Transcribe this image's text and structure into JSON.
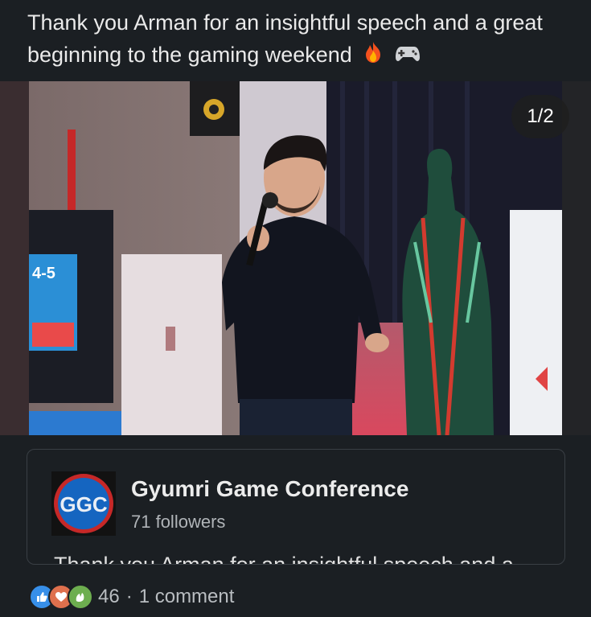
{
  "post": {
    "text": "Thank you Arman for an insightful speech and a great beginning to the gaming weekend",
    "emojis": [
      "fire-emoji",
      "game-controller-emoji"
    ]
  },
  "carousel": {
    "counter": "1/2"
  },
  "shared_card": {
    "logo_text": "GGC",
    "company_name": "Gyumri Game Conference",
    "followers": "71 followers",
    "snippet": "Thank you Arman for an insightful speech and a"
  },
  "social": {
    "reactions": [
      "like-reaction",
      "love-reaction",
      "celebrate-reaction"
    ],
    "reaction_count": "46",
    "separator": "·",
    "comments": "1 comment"
  },
  "colors": {
    "background": "#1b1f23",
    "like": "#378fe9",
    "love": "#df704d",
    "celebrate": "#6dae4f"
  }
}
